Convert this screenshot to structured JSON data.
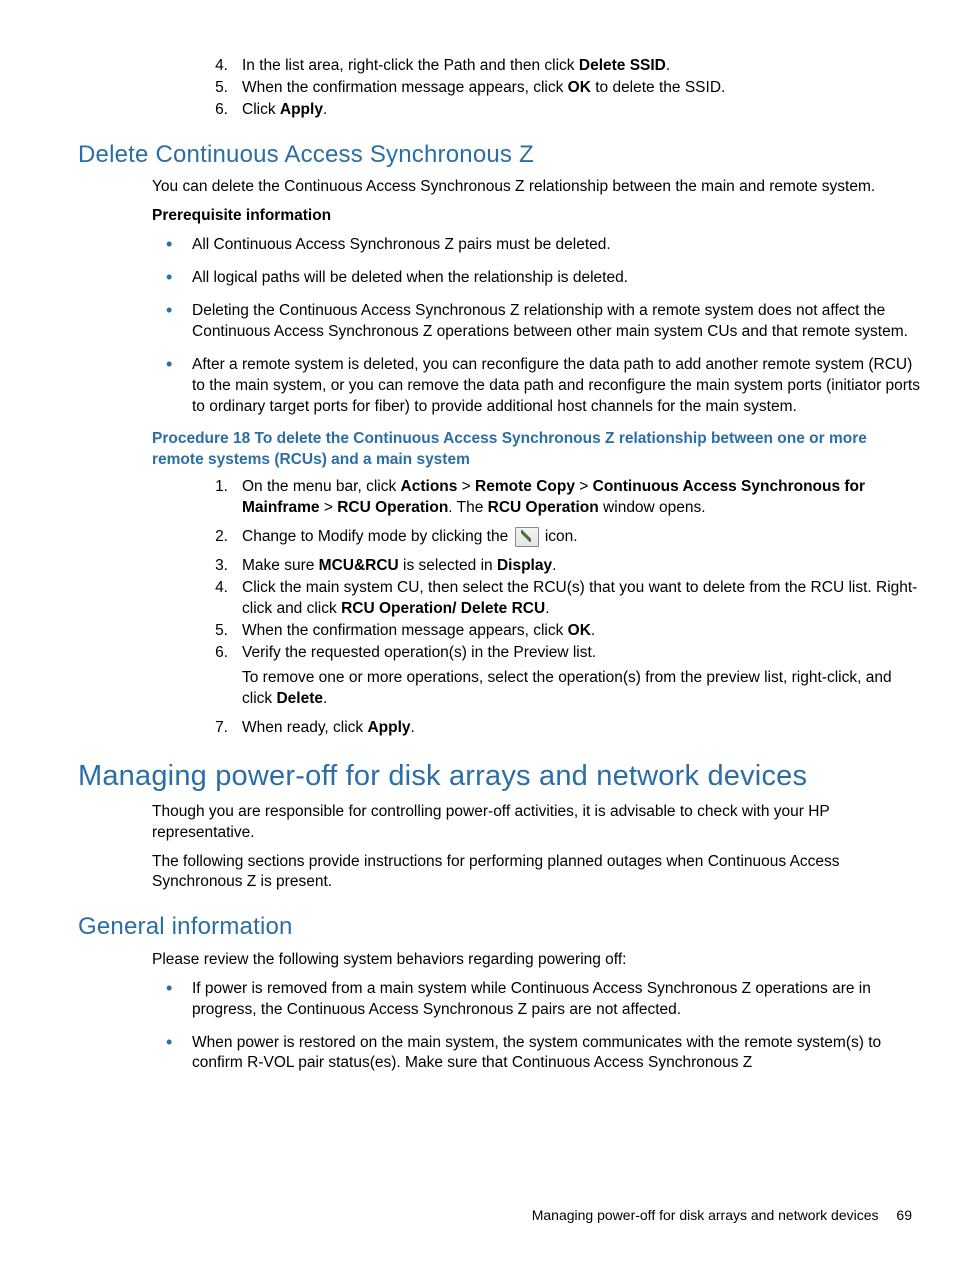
{
  "intro_list": [
    {
      "n": "4.",
      "pre": "In the list area, right-click the Path and then click ",
      "b": "Delete SSID",
      "post": "."
    },
    {
      "n": "5.",
      "pre": "When the confirmation message appears, click ",
      "b": "OK",
      "post": " to delete the SSID."
    },
    {
      "n": "6.",
      "pre": "Click ",
      "b": "Apply",
      "post": "."
    }
  ],
  "sec1": {
    "title": "Delete Continuous Access Synchronous Z",
    "p1": "You can delete the Continuous Access Synchronous Z relationship between the main and remote system.",
    "prereq": "Prerequisite information",
    "bullets": [
      "All Continuous Access Synchronous Z pairs must be deleted.",
      "All logical paths will be deleted when the relationship is deleted.",
      "Deleting the Continuous Access Synchronous Z relationship with a remote system does not affect the Continuous Access Synchronous Z operations between other main system CUs and that remote system.",
      "After a remote system is deleted, you can reconfigure the data path to add another remote system (RCU) to the main system, or you can remove the data path and reconfigure the main system ports (initiator ports to ordinary target ports for fiber) to provide additional host channels for the main system."
    ],
    "proc_title": "Procedure 18 To delete the Continuous Access Synchronous Z relationship between one or more remote systems (RCUs) and a main system",
    "step1": {
      "n": "1.",
      "t0": "On the menu bar, click ",
      "b1": "Actions",
      "sep1": " > ",
      "b2": "Remote Copy",
      "sep2": " > ",
      "b3": "Continuous Access Synchronous for Mainframe",
      "sep3": " > ",
      "b4": "RCU Operation",
      "post1": ". The ",
      "b5": "RCU Operation",
      "post2": " window opens."
    },
    "step2": {
      "n": "2.",
      "pre": "Change to Modify mode by clicking the ",
      "post": " icon."
    },
    "step3": {
      "n": "3.",
      "pre": "Make sure ",
      "b1": "MCU&RCU",
      "mid": " is selected in ",
      "b2": "Display",
      "post": "."
    },
    "step4": {
      "n": "4.",
      "line1": "Click the main system CU, then select the RCU(s) that you want to delete from the RCU list. Right-click and click ",
      "b": "RCU Operation/ Delete RCU",
      "post": "."
    },
    "step5": {
      "n": "5.",
      "pre": "When the confirmation message appears, click ",
      "b": "OK",
      "post": "."
    },
    "step6": {
      "n": "6.",
      "l1": "Verify the requested operation(s) in the Preview list.",
      "l2a": "To remove one or more operations, select the operation(s) from the preview list, right-click, and click ",
      "b": "Delete",
      "l2b": "."
    },
    "step7": {
      "n": "7.",
      "pre": "When ready, click ",
      "b": "Apply",
      "post": "."
    }
  },
  "sec2": {
    "title": "Managing power-off for disk arrays and network devices",
    "p1": "Though you are responsible for controlling power-off activities, it is advisable to check with your HP representative.",
    "p2": "The following sections provide instructions for performing planned outages when Continuous Access Synchronous Z is present."
  },
  "sec3": {
    "title": "General information",
    "p1": "Please review the following system behaviors regarding powering off:",
    "bullets": [
      "If power is removed from a main system while Continuous Access Synchronous Z operations are in progress, the Continuous Access Synchronous Z pairs are not affected.",
      "When power is restored on the main system, the system communicates with the remote system(s) to confirm R-VOL pair status(es). Make sure that Continuous Access Synchronous Z"
    ]
  },
  "footer": {
    "text": "Managing power-off for disk arrays and network devices",
    "page": "69"
  }
}
